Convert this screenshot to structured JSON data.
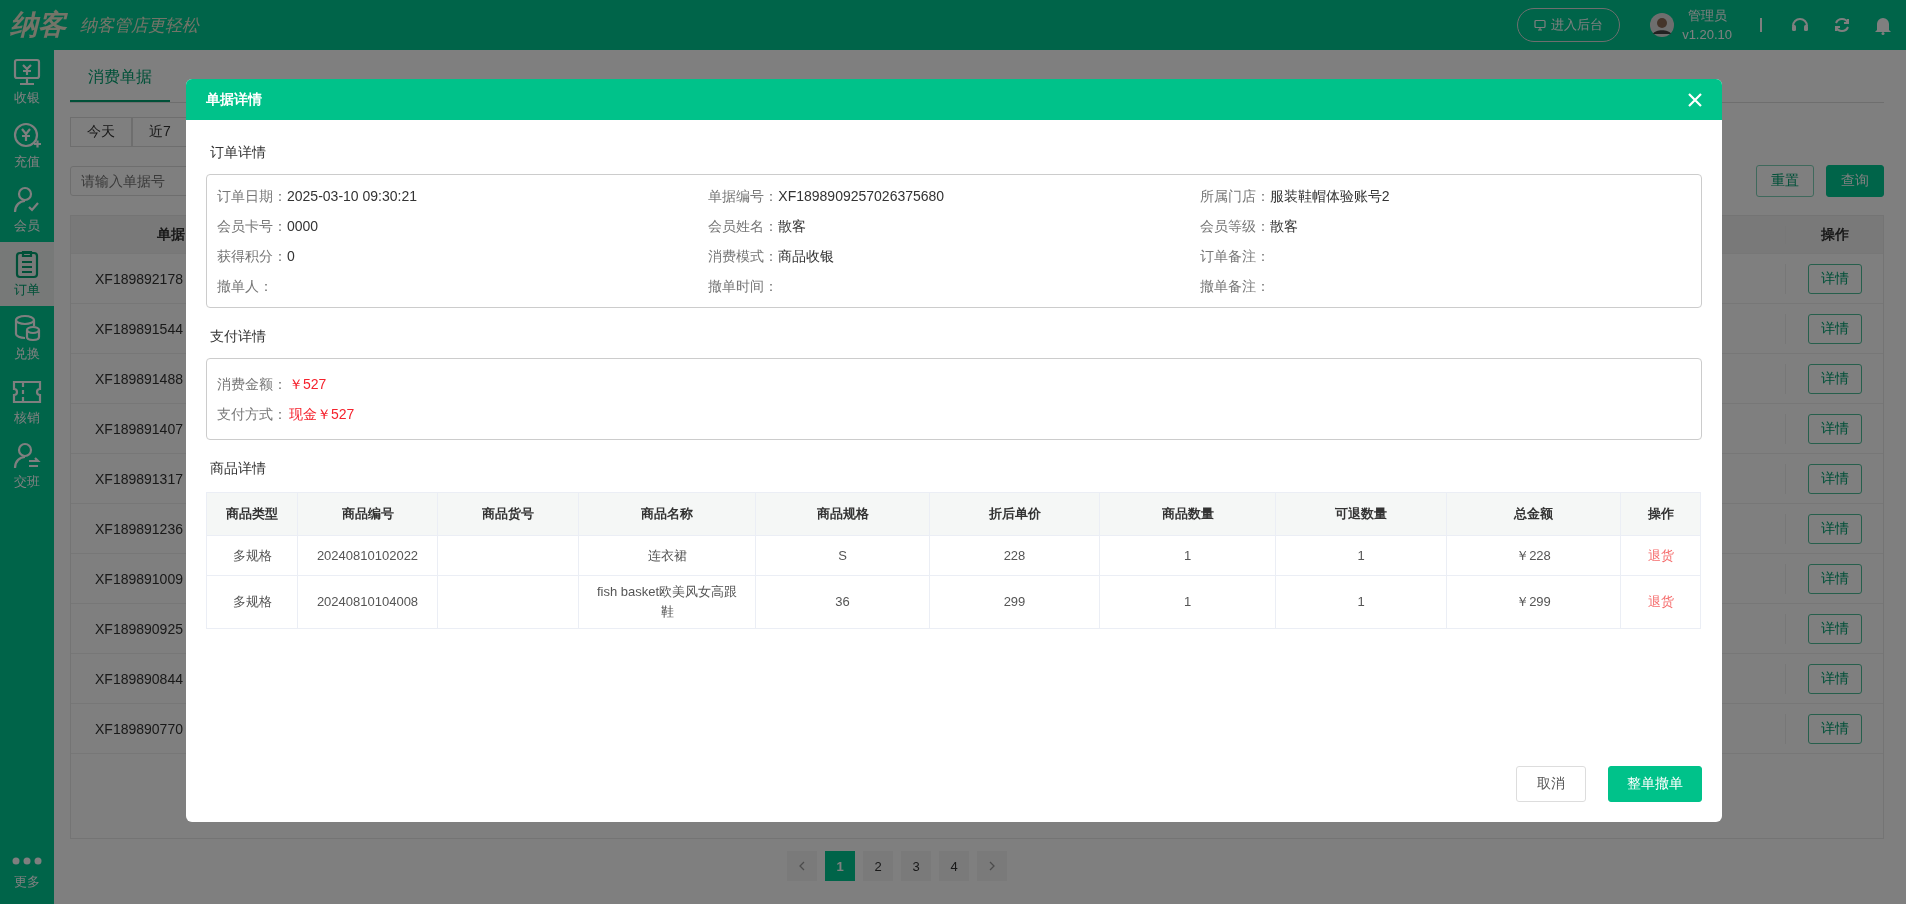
{
  "header": {
    "logo": "纳客",
    "slogan": "纳客管店更轻松",
    "admin_button": "进入后台",
    "user": "管理员",
    "version": "v1.20.10"
  },
  "sidebar": {
    "items": [
      {
        "label": "收银",
        "selected": false
      },
      {
        "label": "充值",
        "selected": false
      },
      {
        "label": "会员",
        "selected": false
      },
      {
        "label": "订单",
        "selected": true
      },
      {
        "label": "兑换",
        "selected": false
      },
      {
        "label": "核销",
        "selected": false
      },
      {
        "label": "交班",
        "selected": false
      }
    ],
    "more": "更多"
  },
  "tabs": [
    {
      "label": "消费单据",
      "selected": true
    }
  ],
  "date_filters": [
    "今天",
    "近7"
  ],
  "search": {
    "placeholder": "请输入单据号"
  },
  "filter_buttons": [
    "重置",
    "查询"
  ],
  "table": {
    "columns": [
      "单据",
      "操作"
    ],
    "rows": [
      {
        "number": "XF189892178",
        "action": "详情"
      },
      {
        "number": "XF189891544",
        "action": "详情"
      },
      {
        "number": "XF189891488",
        "action": "详情"
      },
      {
        "number": "XF189891407",
        "action": "详情"
      },
      {
        "number": "XF189891317",
        "action": "详情"
      },
      {
        "number": "XF189891236",
        "action": "详情"
      },
      {
        "number": "XF189891009",
        "action": "详情"
      },
      {
        "number": "XF189890925",
        "action": "详情"
      },
      {
        "number": "XF189890844",
        "action": "详情"
      },
      {
        "number": "XF189890770",
        "action": "详情"
      }
    ]
  },
  "pagination": [
    {
      "label": "1",
      "selected": true
    },
    {
      "label": "2",
      "selected": false
    },
    {
      "label": "3",
      "selected": false
    },
    {
      "label": "4",
      "selected": false
    }
  ],
  "dialog": {
    "title": "单据详情",
    "order_section": "订单详情",
    "order_fields": [
      {
        "label": "订单日期：",
        "value": "2025-03-10 09:30:21"
      },
      {
        "label": "单据编号：",
        "value": "XF1898909257026375680"
      },
      {
        "label": "所属门店：",
        "value": "服装鞋帽体验账号2"
      },
      {
        "label": "会员卡号：",
        "value": "0000"
      },
      {
        "label": "会员姓名：",
        "value": "散客"
      },
      {
        "label": "会员等级：",
        "value": "散客"
      },
      {
        "label": "获得积分：",
        "value": "0"
      },
      {
        "label": "消费模式：",
        "value": "商品收银"
      },
      {
        "label": "订单备注："
      },
      {
        "label": "撤单人："
      },
      {
        "label": "撤单时间："
      },
      {
        "label": "撤单备注："
      }
    ],
    "payment_section": "支付详情",
    "payment_fields": [
      {
        "label": "消费金额：",
        "value": "￥527"
      },
      {
        "label": "支付方式：",
        "value": "现金￥527"
      }
    ],
    "goods_section": "商品详情",
    "goods_columns": [
      "商品类型",
      "商品编号",
      "商品货号",
      "商品名称",
      "商品规格",
      "折后单价",
      "商品数量",
      "可退数量",
      "总金额",
      "操作"
    ],
    "goods_rows": [
      {
        "type": "多规格",
        "code": "20240810102022",
        "name": "连衣裙",
        "spec": "S",
        "price": "228",
        "quantity": "1",
        "returnable": "1",
        "total": "￥228",
        "action": "退货"
      },
      {
        "type": "多规格",
        "code": "20240810104008",
        "name": "fish basket欧美风女高跟鞋",
        "spec": "36",
        "price": "299",
        "quantity": "1",
        "returnable": "1",
        "total": "￥299",
        "action": "退货"
      }
    ],
    "buttons": [
      "取消",
      "整单撤单"
    ]
  }
}
